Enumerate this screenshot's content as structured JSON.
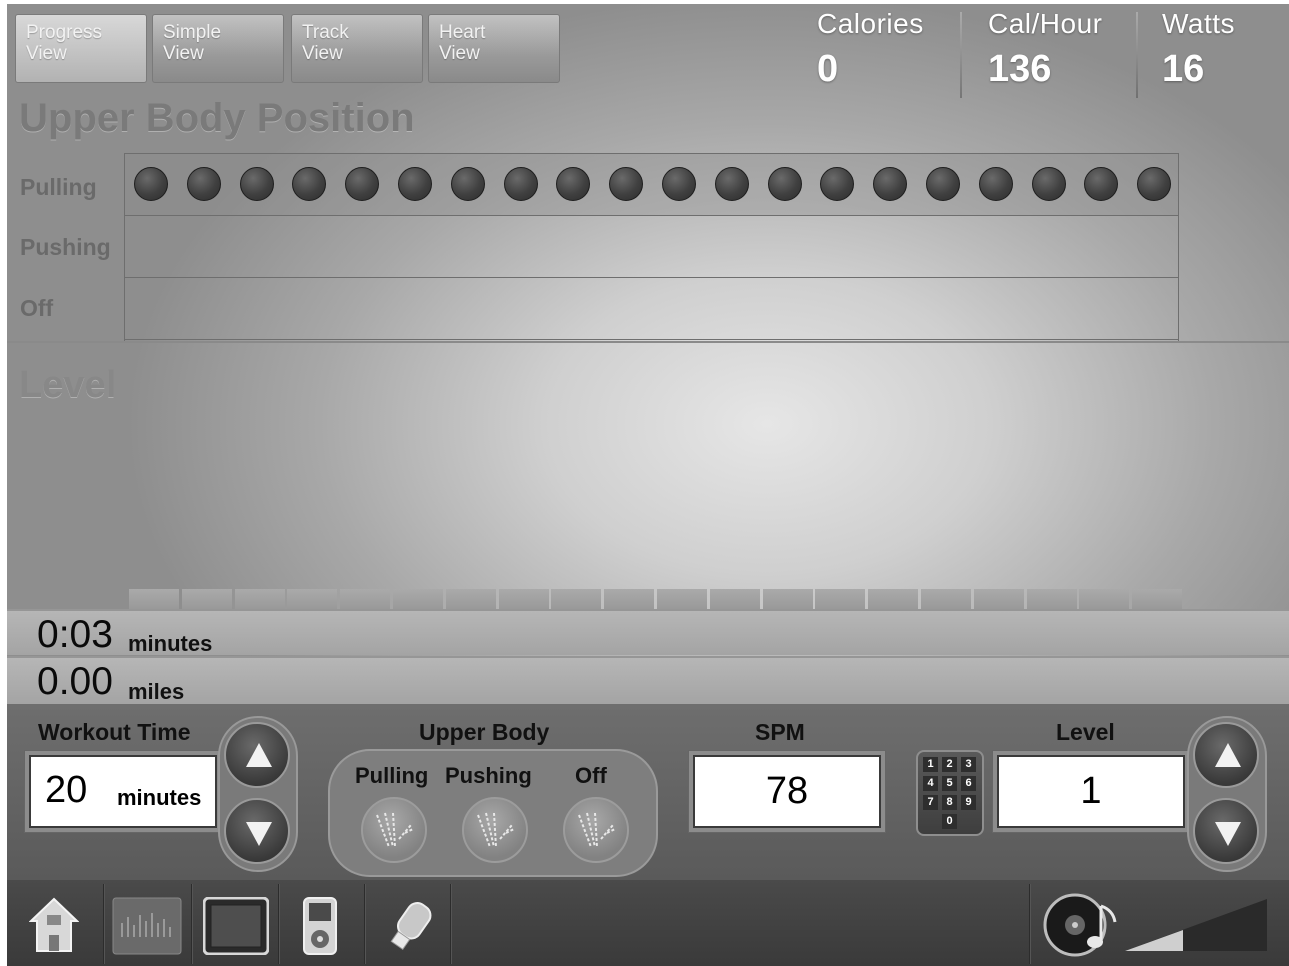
{
  "tabs": [
    {
      "label": "Progress\nView",
      "active": true
    },
    {
      "label": "Simple\nView",
      "active": false
    },
    {
      "label": "Track\nView",
      "active": false
    },
    {
      "label": "Heart\nView",
      "active": false
    }
  ],
  "stats": {
    "calories": {
      "label": "Calories",
      "value": "0"
    },
    "cal_hour": {
      "label": "Cal/Hour",
      "value": "136"
    },
    "watts": {
      "label": "Watts",
      "value": "16"
    }
  },
  "upper_body": {
    "title": "Upper Body Position",
    "rows": [
      "Pulling",
      "Pushing",
      "Off"
    ],
    "active_row": "Pulling",
    "segment_count": 20
  },
  "level_section": {
    "title": "Level",
    "bar_count": 20
  },
  "progress": {
    "time": {
      "value": "0:03",
      "unit": "minutes"
    },
    "distance": {
      "value": "0.00",
      "unit": "miles"
    }
  },
  "controls": {
    "workout_time": {
      "label": "Workout Time",
      "value": "20",
      "unit": "minutes"
    },
    "upper_body": {
      "label": "Upper Body",
      "options": [
        "Pulling",
        "Pushing",
        "Off"
      ]
    },
    "spm": {
      "label": "SPM",
      "value": "78"
    },
    "keypad": {
      "keys": [
        "1",
        "2",
        "3",
        "4",
        "5",
        "6",
        "7",
        "8",
        "9",
        "0"
      ]
    },
    "level": {
      "label": "Level",
      "value": "1"
    }
  },
  "taskbar": {
    "icons": [
      "home-icon",
      "equalizer-icon",
      "tv-screen-icon",
      "media-player-icon",
      "usb-drive-icon",
      "speaker-music-icon",
      "volume-level-icon"
    ]
  },
  "colors": {
    "accent_text": "#ffffff",
    "dot_fill": "#404040",
    "panel_bg": "#606060"
  }
}
